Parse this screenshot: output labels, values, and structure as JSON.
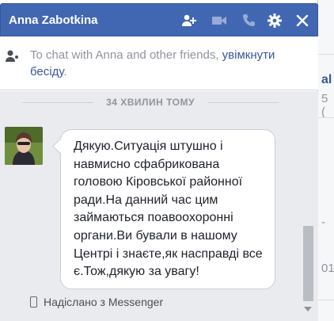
{
  "chat": {
    "title": "Anna Zabotkina",
    "header_icons": [
      "add-friend-icon",
      "video-call-icon",
      "voice-call-icon",
      "gear-icon",
      "close-icon"
    ],
    "invite_text": "To chat with Anna and other friends,",
    "invite_link": "увімкнути бесіду",
    "invite_suffix": ".",
    "timestamp": "34 ХВИЛИН ТОМУ",
    "message": "Дякую.Ситуація штушно і навмисно сфабрикована головою Кіровської районної ради.На данний час цим займаються поавоохоронні органи.Ви бували в нашому Центрі і знаєте,як насправді все є.Тож,дякую за увагу!",
    "sent_via": "Надіслано з Messenger"
  },
  "background_page": {
    "fragments": [
      "al",
      "5 (",
      "- ",
      "01"
    ]
  },
  "colors": {
    "header": "#4267b2",
    "link": "#365899",
    "conversation_bg": "#e9ebee"
  }
}
